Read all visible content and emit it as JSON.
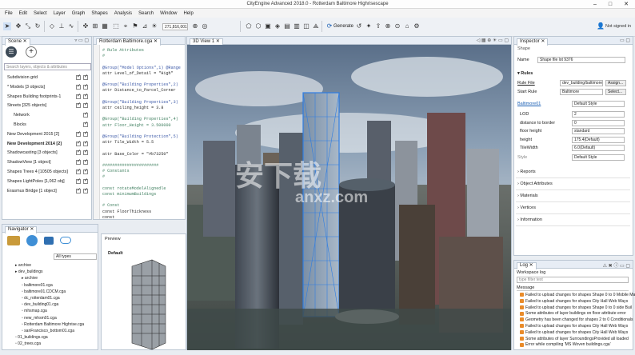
{
  "window": {
    "title": "CityEngine Advanced 2018.0 - Rotterdam Baltimore Highrisescape"
  },
  "menu": [
    "File",
    "Edit",
    "Select",
    "Layer",
    "Graph",
    "Shapes",
    "Analysis",
    "Search",
    "Window",
    "Help"
  ],
  "toolbar": {
    "coordinate": "271,816,001",
    "generate": "Generate",
    "not_signed_in": "Not signed in"
  },
  "scene": {
    "tab": "Scene",
    "search_placeholder": "Search layers, objects & attributes",
    "items": [
      {
        "label": "Subdivision grid",
        "checks": 2
      },
      {
        "label": "* Models [3 objects]",
        "checks": 2
      },
      {
        "label": "Shapes Building footprints-1",
        "checks": 2
      },
      {
        "label": "Streets [325 objects]",
        "checks": 2
      },
      {
        "label": "Network",
        "checks": 1
      },
      {
        "label": "Blocks",
        "checks": 1
      },
      {
        "label": "New Development 2015 [2]",
        "checks": 2
      },
      {
        "label": "New Development 2014 [2]",
        "checks": 2
      },
      {
        "label": "Shadowcasting [3 objects]",
        "checks": 2
      },
      {
        "label": "ShadowView [1 object]",
        "checks": 2
      },
      {
        "label": "Shapes Trees 4 [10505 objects]",
        "checks": 2
      },
      {
        "label": "Shapes LightPoles [1,062 obj]",
        "checks": 2
      },
      {
        "label": "Erasmus Bridge [1 object]",
        "checks": 2
      }
    ]
  },
  "editor": {
    "tab": "Rotterdam Baltimore.cga",
    "lines": [
      {
        "t": "# Rule Attributes",
        "c": "green"
      },
      {
        "t": "#",
        "c": "green"
      },
      {
        "t": "",
        "c": "black"
      },
      {
        "t": "@Group(\"Model Options\",1) @Range",
        "c": "blue"
      },
      {
        "t": "attr Level_of_Detail = \"High\"",
        "c": "black"
      },
      {
        "t": "",
        "c": "black"
      },
      {
        "t": "@Group(\"Building Properties\",2)",
        "c": "blue"
      },
      {
        "t": "attr Distance_to_Parcel_Corner",
        "c": "black"
      },
      {
        "t": "",
        "c": "black"
      },
      {
        "t": "@Group(\"Building Properties\",3)",
        "c": "blue"
      },
      {
        "t": "attr ceiling_height = 3.8",
        "c": "black"
      },
      {
        "t": "",
        "c": "black"
      },
      {
        "t": "@Group(\"Building Properties\",4)",
        "c": "green"
      },
      {
        "t": "attr Floor_Height = 3.500000",
        "c": "green"
      },
      {
        "t": "",
        "c": "black"
      },
      {
        "t": "@Group(\"Building Protection\",5)",
        "c": "blue"
      },
      {
        "t": "attr Tile_Width = 5.5",
        "c": "black"
      },
      {
        "t": "",
        "c": "black"
      },
      {
        "t": "attr Base_Color = \"#b73250\"",
        "c": "black"
      },
      {
        "t": "",
        "c": "black"
      },
      {
        "t": "#######################",
        "c": "green"
      },
      {
        "t": "# Constants",
        "c": "green"
      },
      {
        "t": "#",
        "c": "green"
      },
      {
        "t": "",
        "c": "black"
      },
      {
        "t": "const rotateModelAlignedle",
        "c": "green"
      },
      {
        "t": "const minimumBuildings",
        "c": "green"
      },
      {
        "t": "",
        "c": "black"
      },
      {
        "t": "# Const",
        "c": "green"
      },
      {
        "t": "const FloorThickness",
        "c": "black"
      },
      {
        "t": "const",
        "c": "black"
      }
    ]
  },
  "viewport": {
    "tab": "3D View 1"
  },
  "inspector": {
    "tab": "Inspector",
    "object_type": "Shape",
    "name_label": "Name",
    "name_value": "Shape file lot 9376",
    "rules_header": "Rules",
    "rule_file_label": "Rule File",
    "rule_file_value": "dev_building/baltimore...",
    "assign_button": "Assign...",
    "start_rule_label": "Start Rule",
    "start_rule_value": "Baltimore",
    "select_button": "Select...",
    "group_label": "Baltimore01",
    "group_value": "Default Style",
    "attrs": [
      {
        "label": "LOD",
        "value": "2"
      },
      {
        "label": "distance to border",
        "value": "0"
      },
      {
        "label": "floor height",
        "value": "standard"
      },
      {
        "label": "height",
        "value": "175.4(Default)"
      },
      {
        "label": "TileWidth",
        "value": "6.0(Default)"
      }
    ],
    "style_label": "Style",
    "style_value": "Default Style",
    "sections": [
      "Reports",
      "Object Attributes",
      "Materials",
      "Vertices",
      "Information"
    ]
  },
  "navigator": {
    "tab": "Navigator",
    "filter": "All types",
    "preview_label": "Preview",
    "preview_title": "Default",
    "tree": [
      {
        "label": "archive",
        "indent": 1
      },
      {
        "label": "dev_buildings",
        "indent": 1
      },
      {
        "label": "archive",
        "indent": 2
      },
      {
        "label": "baltimore01.cga",
        "indent": 2
      },
      {
        "label": "baltimore01.CDCM.cga",
        "indent": 2
      },
      {
        "label": "dc_rotterdam01.cga",
        "indent": 2
      },
      {
        "label": "dev_building01.cga",
        "indent": 2
      },
      {
        "label": "mhsmap.cga",
        "indent": 2
      },
      {
        "label": "new_mhsm01.cga",
        "indent": 2
      },
      {
        "label": "Rotterdam Baltimore Highrise.cga",
        "indent": 2
      },
      {
        "label": "sanFrancisco_bottom01.cga",
        "indent": 2
      },
      {
        "label": "01_buildings.cga",
        "indent": 1
      },
      {
        "label": "02_trees.cga",
        "indent": 1
      }
    ]
  },
  "log": {
    "tab": "Log",
    "title": "Workspace log",
    "filter_placeholder": "type filter text",
    "column": "Message",
    "messages": [
      "Failed to upload changes for shapes Shape 0 to 0 Mobile Ma",
      "Failed to upload changes for shapes City Hall Web Ways",
      "Failed to upload changes for shapes Shape 0 to 0 side Buil",
      "Some attributes of layer buildings on floor attribute error",
      "Geometry has been changed for shapes 2 to 0 Conditionals",
      "Failed to upload changes for shapes City Hall Web Ways",
      "Failed to upload changes for shapes City Hall Web Ways",
      "Some attributes of layer SurroundingsProvided all loaded",
      "Error while compiling 'MS Woven buildings.cga'"
    ]
  },
  "watermark": {
    "brand": "安下载",
    "domain": "anxz.com"
  }
}
